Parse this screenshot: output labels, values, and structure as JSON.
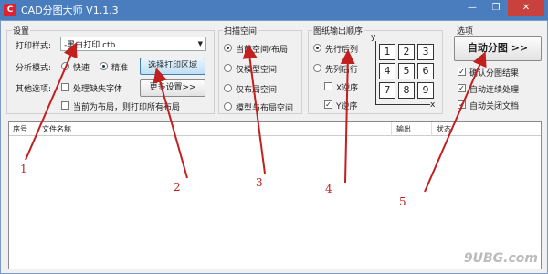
{
  "window": {
    "title": "CAD分图大师 V1.1.3",
    "app_icon_glyph": "C",
    "minimize": "—",
    "restore": "❐",
    "close": "✕"
  },
  "settings": {
    "title": "设置",
    "print_style_label": "打印样式:",
    "print_style_value": "-黑白打印.ctb",
    "analysis_mode_label": "分析模式:",
    "analysis_fast": "快速",
    "analysis_precise": "精准",
    "select_print_area_button": "选择打印区域",
    "other_options_label": "其他选项:",
    "handle_missing_font": "处理缺失字体",
    "more_settings_button": "更多设置>>",
    "print_all_layouts": "当前为布局，则打印所有布局"
  },
  "scan_space": {
    "title": "扫描空间",
    "options": [
      "当前空间/布局",
      "仅模型空间",
      "仅布局空间",
      "模型与布局空间"
    ]
  },
  "output_order": {
    "title": "图纸输出顺序",
    "row_first": "先行后列",
    "col_first": "先列后行",
    "x_reverse": "X逆序",
    "y_reverse": "Y逆序",
    "grid": [
      "1",
      "2",
      "3",
      "4",
      "5",
      "6",
      "7",
      "8",
      "9"
    ],
    "axis_y": "y",
    "axis_x": "x"
  },
  "options": {
    "title": "选项",
    "auto_split_button": "自动分图 >>",
    "confirm_result": "确认分图结果",
    "auto_continue": "自动连续处理",
    "auto_close": "自动关闭文档"
  },
  "list": {
    "columns": [
      "序号",
      "文件名称",
      "输出",
      "状态"
    ]
  },
  "annotations": [
    "1",
    "2",
    "3",
    "4",
    "5"
  ],
  "watermark": "9UBG.com",
  "colors": {
    "annotation": "#c21f1f",
    "titlebar": "#4a7dbd"
  }
}
